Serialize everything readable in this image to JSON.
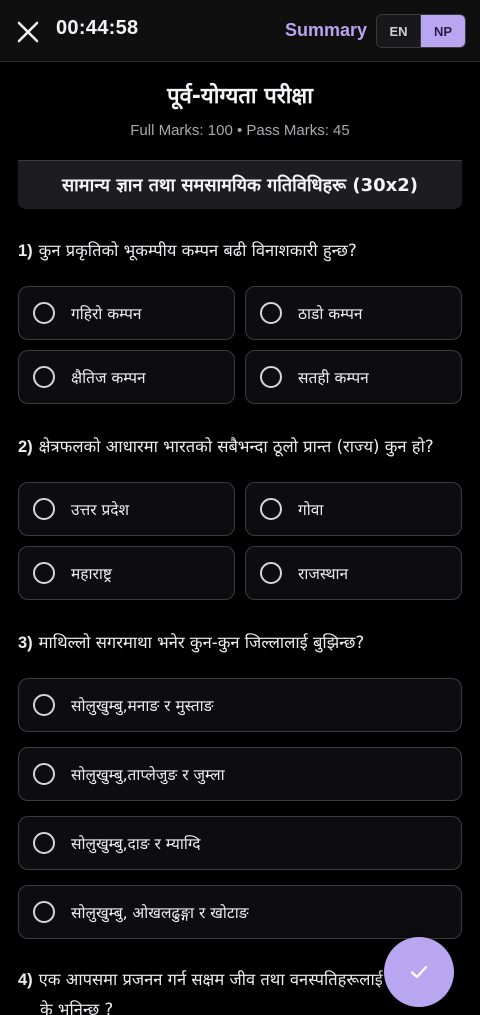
{
  "header": {
    "timer": "00:44:58",
    "summary_label": "Summary",
    "lang_en": "EN",
    "lang_np": "NP",
    "accent_color": "#b9a6f0"
  },
  "exam": {
    "title": "पूर्व-योग्यता परीक्षा",
    "marks": "Full Marks: 100 • Pass Marks: 45",
    "section": "सामान्य ज्ञान तथा समसामयिक गतिविधिहरू (30x2)"
  },
  "questions": [
    {
      "number": "1)",
      "text": "कुन प्रकृतिको भूकम्पीय कम्पन बढी विनाशकारी हुन्छ?",
      "options": [
        "गहिरो कम्पन",
        "ठाडो कम्पन",
        "क्षैतिज कम्पन",
        "सतही कम्पन"
      ]
    },
    {
      "number": "2)",
      "text": "क्षेत्रफलको आधारमा भारतको सबैभन्दा ठूलो प्रान्त (राज्य) कुन हो?",
      "options": [
        "उत्तर प्रदेश",
        "गोवा",
        "महाराष्ट्र",
        "राजस्थान"
      ]
    },
    {
      "number": "3)",
      "text": "माथिल्लो सगरमाथा भनेर कुन-कुन जिल्लालाई बुझिन्छ?",
      "options": [
        "सोलुखुम्बु,मनाङ र मुस्ताङ",
        "सोलुखुम्बु,ताप्लेजुङ र जुम्ला",
        "सोलुखुम्बु,दाङ र म्याग्दि",
        "सोलुखुम्बु, ओखलढुङ्गा र खोटाङ"
      ]
    },
    {
      "number": "4)",
      "text_line1": "एक आपसमा प्रजनन गर्न सक्षम जीव तथा वनस्पतिहरूलाई",
      "text_line2": "के भनिन्छ ?"
    }
  ],
  "icons": {
    "close": "close-icon",
    "submit": "check-icon",
    "radio": "radio-unselected-icon"
  }
}
